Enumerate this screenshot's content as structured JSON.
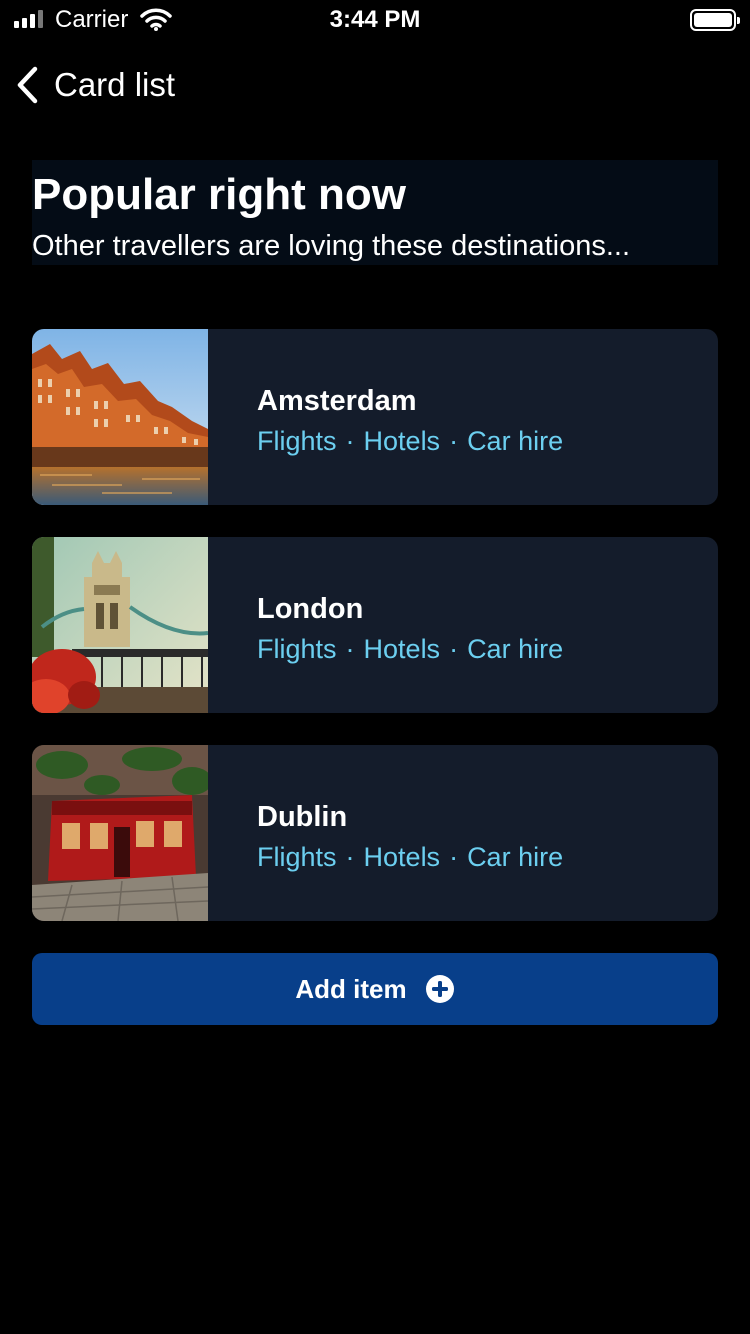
{
  "status_bar": {
    "carrier": "Carrier",
    "time": "3:44 PM",
    "icons": [
      "signal-icon",
      "wifi-icon",
      "battery-icon"
    ]
  },
  "nav": {
    "back_icon": "chevron-left-icon",
    "title": "Card list"
  },
  "header": {
    "title": "Popular right now",
    "subtitle": "Other travellers are loving these destinations..."
  },
  "cards": [
    {
      "title": "Amsterdam",
      "links": [
        "Flights",
        "Hotels",
        "Car hire"
      ],
      "separator": "·"
    },
    {
      "title": "London",
      "links": [
        "Flights",
        "Hotels",
        "Car hire"
      ],
      "separator": "·"
    },
    {
      "title": "Dublin",
      "links": [
        "Flights",
        "Hotels",
        "Car hire"
      ],
      "separator": "·"
    }
  ],
  "add_button": {
    "label": "Add item",
    "icon": "plus-circle-icon"
  },
  "colors": {
    "background": "#000000",
    "card_background": "#141c2b",
    "link": "#6ccff0",
    "button": "#083f8a"
  }
}
